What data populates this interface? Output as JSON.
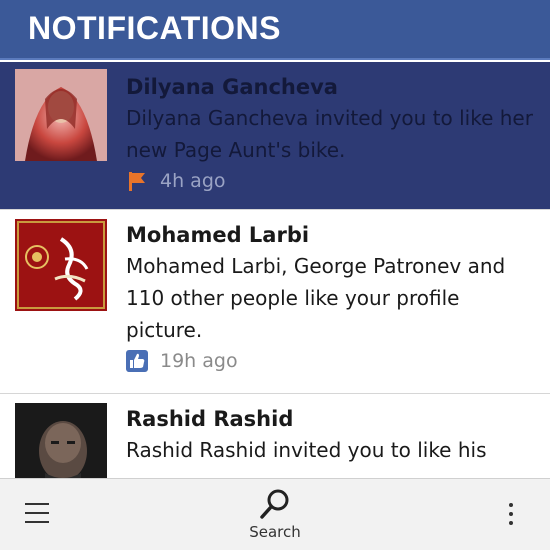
{
  "header": {
    "title": "NOTIFICATIONS"
  },
  "notifications": [
    {
      "name": "Dilyana Gancheva",
      "text": "Dilyana Gancheva invited you to like her new Page Aunt's bike.",
      "time": "4h ago",
      "icon": "page-flag-icon",
      "highlighted": true
    },
    {
      "name": "Mohamed Larbi",
      "text": "Mohamed Larbi, George Patronev and 110 other people like your profile picture.",
      "time": "19h ago",
      "icon": "like-thumb-icon",
      "highlighted": false
    },
    {
      "name": "Rashid Rashid",
      "text": "Rashid Rashid invited you to like his",
      "highlighted": false
    }
  ],
  "bottombar": {
    "search_label": "Search",
    "menu_icon": "hamburger-menu-icon",
    "overflow_icon": "more-vertical-icon"
  },
  "colors": {
    "header": "#3b5998",
    "highlight": "#2d3a74",
    "like_blue": "#4a6fb5",
    "flag_orange": "#e8742a"
  }
}
